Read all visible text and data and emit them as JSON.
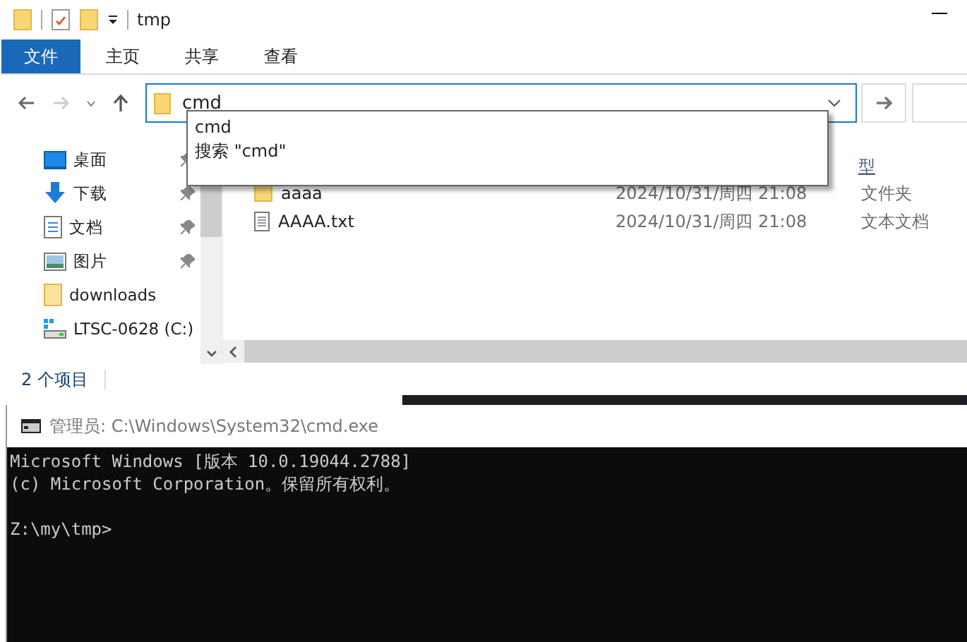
{
  "explorer": {
    "title": "tmp",
    "ribbon_tabs": [
      {
        "label": "文件",
        "selected": true
      },
      {
        "label": "主页",
        "selected": false
      },
      {
        "label": "共享",
        "selected": false
      },
      {
        "label": "查看",
        "selected": false
      }
    ],
    "address": {
      "value": "cmd"
    },
    "suggestions": [
      "cmd",
      "搜索 \"cmd\""
    ],
    "column_header": "型",
    "sidebar": [
      {
        "label": "桌面",
        "kind": "desktop",
        "pinned": true
      },
      {
        "label": "下载",
        "kind": "download",
        "pinned": true
      },
      {
        "label": "文档",
        "kind": "document",
        "pinned": true
      },
      {
        "label": "图片",
        "kind": "pictures",
        "pinned": true
      },
      {
        "label": "downloads",
        "kind": "folder",
        "pinned": false
      },
      {
        "label": "LTSC-0628 (C:)",
        "kind": "drive",
        "pinned": false
      }
    ],
    "files": [
      {
        "name": "aaaa",
        "kind": "folder",
        "modified": "2024/10/31/周四 21:08",
        "type": "文件夹"
      },
      {
        "name": "AAAA.txt",
        "kind": "text",
        "modified": "2024/10/31/周四 21:08",
        "type": "文本文档"
      }
    ],
    "status": "2 个项目"
  },
  "console": {
    "title": "管理员: C:\\Windows\\System32\\cmd.exe",
    "lines": [
      "Microsoft Windows [版本 10.0.19044.2788]",
      "(c) Microsoft Corporation。保留所有权利。"
    ],
    "prompt": "Z:\\my\\tmp>"
  }
}
